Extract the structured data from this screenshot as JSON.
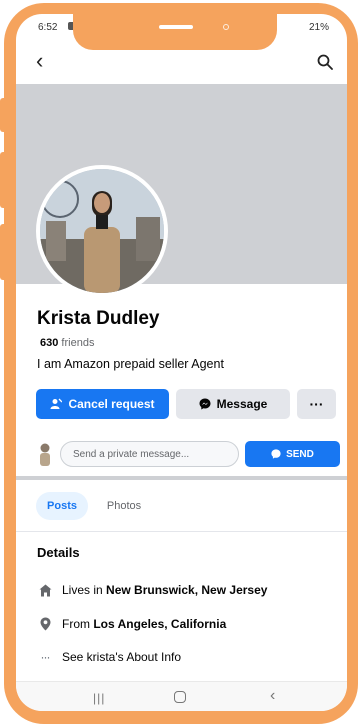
{
  "status_bar": {
    "time": "6:52",
    "right": "21%"
  },
  "profile": {
    "name": "Krista Dudley",
    "friends_count": "630",
    "friends_label": "friends",
    "bio": "I am Amazon  prepaid seller Agent"
  },
  "actions": {
    "cancel_request": "Cancel request",
    "message": "Message",
    "more": "···"
  },
  "private_message": {
    "placeholder": "Send a private message...",
    "send": "SEND"
  },
  "tabs": [
    {
      "label": "Posts",
      "active": true
    },
    {
      "label": "Photos",
      "active": false
    }
  ],
  "details": {
    "title": "Details",
    "items": [
      {
        "icon": "home-icon",
        "prefix": "Lives in ",
        "bold": "New Brunswick, New Jersey"
      },
      {
        "icon": "location-pin-icon",
        "prefix": "From ",
        "bold": "Los Angeles, California"
      },
      {
        "icon": "more-dots-icon",
        "prefix": "See krista's About Info",
        "bold": ""
      }
    ]
  },
  "colors": {
    "frame": "#f5a35d",
    "primary": "#1877f2",
    "cover": "#ced0d4",
    "secondary_button": "#e4e6eb"
  }
}
